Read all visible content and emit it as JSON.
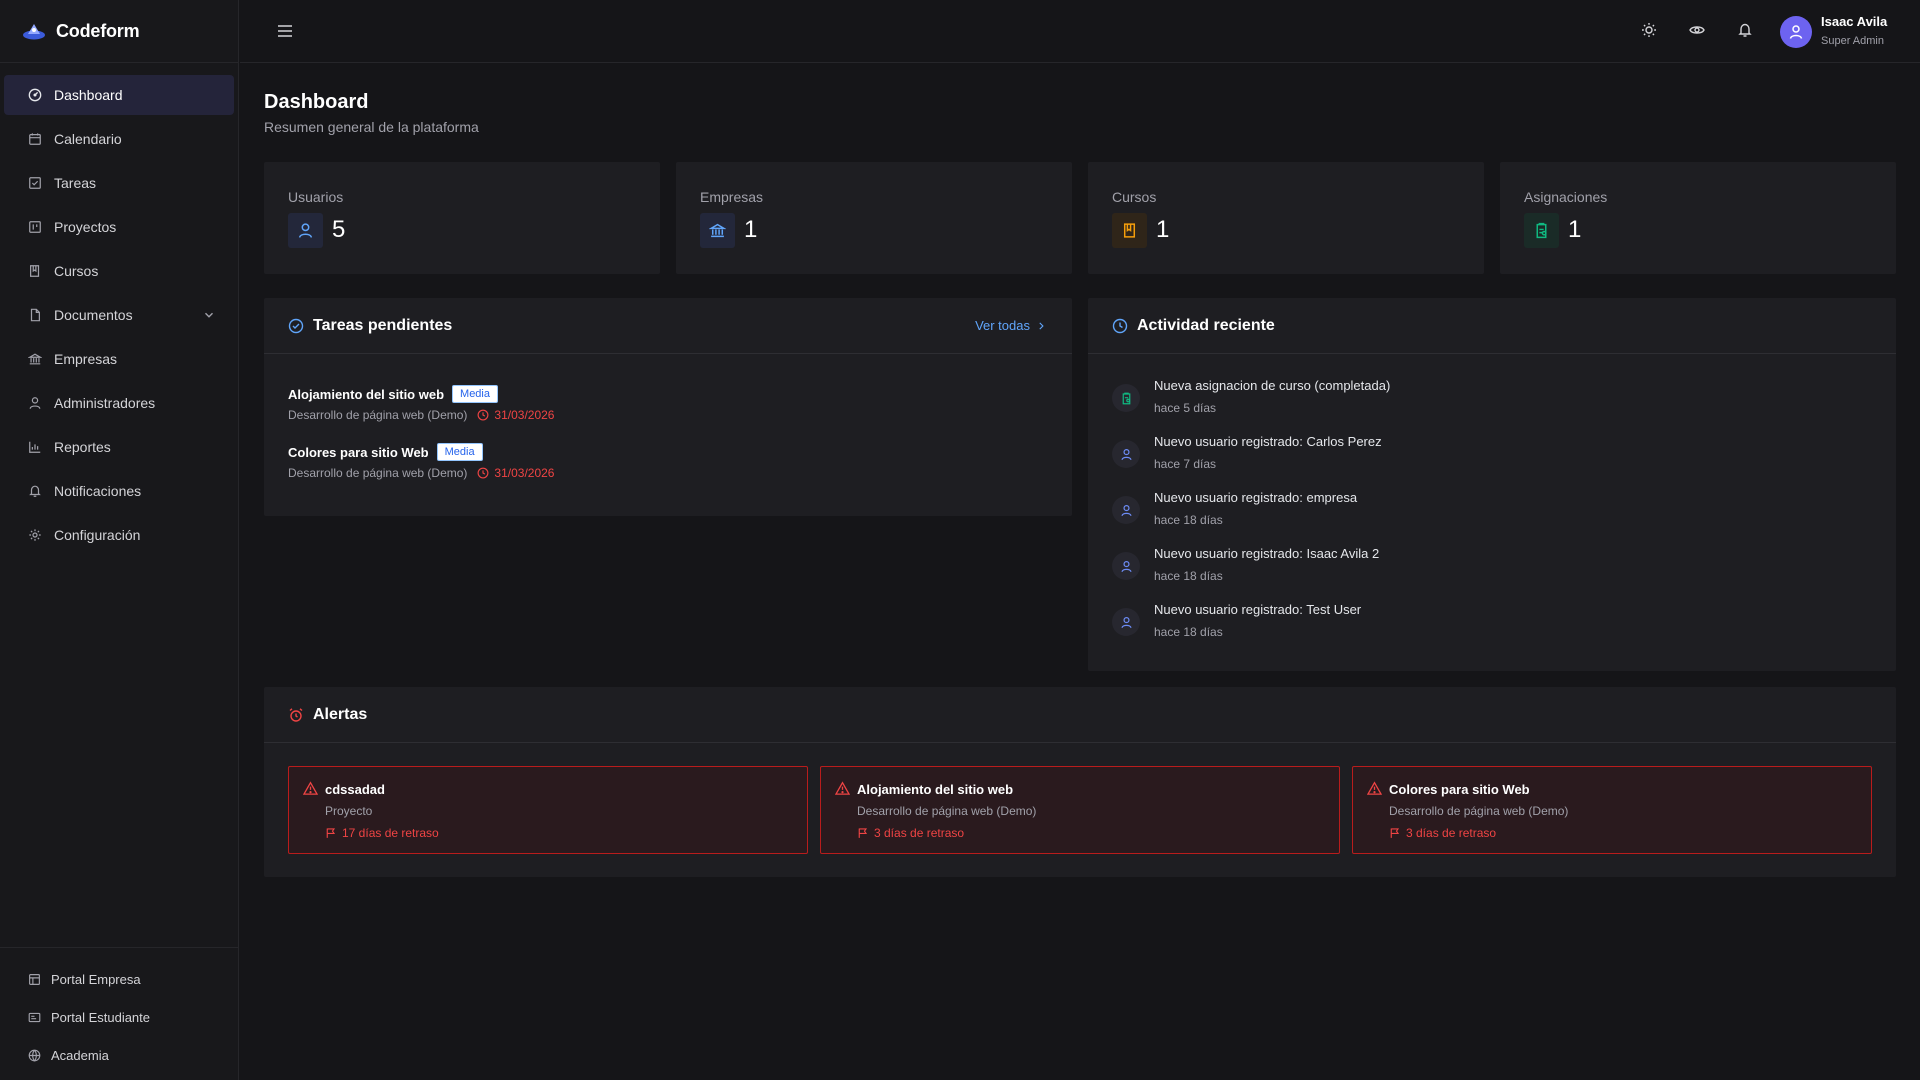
{
  "brand": {
    "name": "Codeform"
  },
  "sidebar": {
    "items": [
      {
        "label": "Dashboard",
        "icon": "gauge-icon",
        "active": true
      },
      {
        "label": "Calendario",
        "icon": "calendar-icon"
      },
      {
        "label": "Tareas",
        "icon": "checkbox-icon"
      },
      {
        "label": "Proyectos",
        "icon": "kanban-icon"
      },
      {
        "label": "Cursos",
        "icon": "book-icon"
      },
      {
        "label": "Documentos",
        "icon": "file-icon",
        "expandable": true
      },
      {
        "label": "Empresas",
        "icon": "bank-icon"
      },
      {
        "label": "Administradores",
        "icon": "user-icon"
      },
      {
        "label": "Reportes",
        "icon": "bar-chart-icon"
      },
      {
        "label": "Notificaciones",
        "icon": "bell-icon"
      },
      {
        "label": "Configuración",
        "icon": "gear-icon"
      }
    ],
    "footer": [
      {
        "label": "Portal Empresa",
        "icon": "building-icon"
      },
      {
        "label": "Portal Estudiante",
        "icon": "id-card-icon"
      },
      {
        "label": "Academia",
        "icon": "globe-icon"
      }
    ]
  },
  "topbar": {
    "user": {
      "name": "Isaac Avila",
      "role": "Super Admin"
    }
  },
  "page": {
    "title": "Dashboard",
    "subtitle": "Resumen general de la plataforma"
  },
  "stats": [
    {
      "label": "Usuarios",
      "value": "5",
      "icon": "user-icon",
      "color": "#60a5fa"
    },
    {
      "label": "Empresas",
      "value": "1",
      "icon": "bank-icon",
      "color": "#60a5fa"
    },
    {
      "label": "Cursos",
      "value": "1",
      "icon": "book-icon",
      "color": "#f59e0b"
    },
    {
      "label": "Asignaciones",
      "value": "1",
      "icon": "clipboard-icon",
      "color": "#10b981"
    }
  ],
  "tasks": {
    "title": "Tareas pendientes",
    "link": "Ver todas",
    "items": [
      {
        "title": "Alojamiento del sitio web",
        "badge": "Media",
        "project": "Desarrollo de página web (Demo)",
        "due": "31/03/2026"
      },
      {
        "title": "Colores para sitio Web",
        "badge": "Media",
        "project": "Desarrollo de página web (Demo)",
        "due": "31/03/2026"
      }
    ]
  },
  "activity": {
    "title": "Actividad reciente",
    "items": [
      {
        "text": "Nueva asignacion de curso (completada)",
        "time": "hace 5 días",
        "icon": "clipboard-icon"
      },
      {
        "text": "Nuevo usuario registrado: Carlos Perez",
        "time": "hace 7 días",
        "icon": "user-icon"
      },
      {
        "text": "Nuevo usuario registrado: empresa",
        "time": "hace 18 días",
        "icon": "user-icon"
      },
      {
        "text": "Nuevo usuario registrado: Isaac Avila 2",
        "time": "hace 18 días",
        "icon": "user-icon"
      },
      {
        "text": "Nuevo usuario registrado: Test User",
        "time": "hace 18 días",
        "icon": "user-icon"
      }
    ]
  },
  "alerts": {
    "title": "Alertas",
    "items": [
      {
        "title": "cdssadad",
        "sub": "Proyecto",
        "delay": "17 días de retraso"
      },
      {
        "title": "Alojamiento del sitio web",
        "sub": "Desarrollo de página web (Demo)",
        "delay": "3 días de retraso"
      },
      {
        "title": "Colores para sitio Web",
        "sub": "Desarrollo de página web (Demo)",
        "delay": "3 días de retraso"
      }
    ]
  },
  "colors": {
    "accent": "#6d63f0",
    "link": "#60a5fa",
    "danger": "#ef4444",
    "sidebar_active": "#24243a",
    "card": "#1e1e22"
  }
}
